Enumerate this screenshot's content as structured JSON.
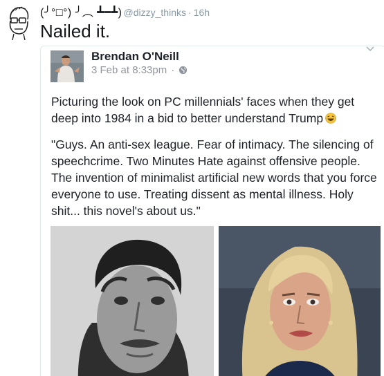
{
  "tweet": {
    "display_name": "(╯°□°) ╯︵ ┻━┻)",
    "handle": "@dizzy_thinks",
    "separator": "·",
    "time": "16h",
    "text": "Nailed it.",
    "avatar_icon": "doodle-face-icon"
  },
  "quoted_post": {
    "author": "Brendan O'Neill",
    "date": "3 Feb at 8:33pm",
    "separator": "·",
    "privacy_icon": "globe-icon",
    "paragraph_1": "Picturing the look on PC millennials' faces when they get deep into 1984 in a bid to better understand Trump",
    "emoji_icon": "laughing-tears-emoji",
    "paragraph_2": "\"Guys. An anti-sex league. Fear of intimacy. The silencing of speechcrime. Two Minutes Hate against offensive people. The invention of minimalist artificial new words that you force everyone to use. Treating dissent as mental illness. Holy shit... this novel's about us.\""
  },
  "colors": {
    "muted_text": "#8899a6",
    "fb_meta": "#90949c",
    "border": "#e1e8ed"
  }
}
